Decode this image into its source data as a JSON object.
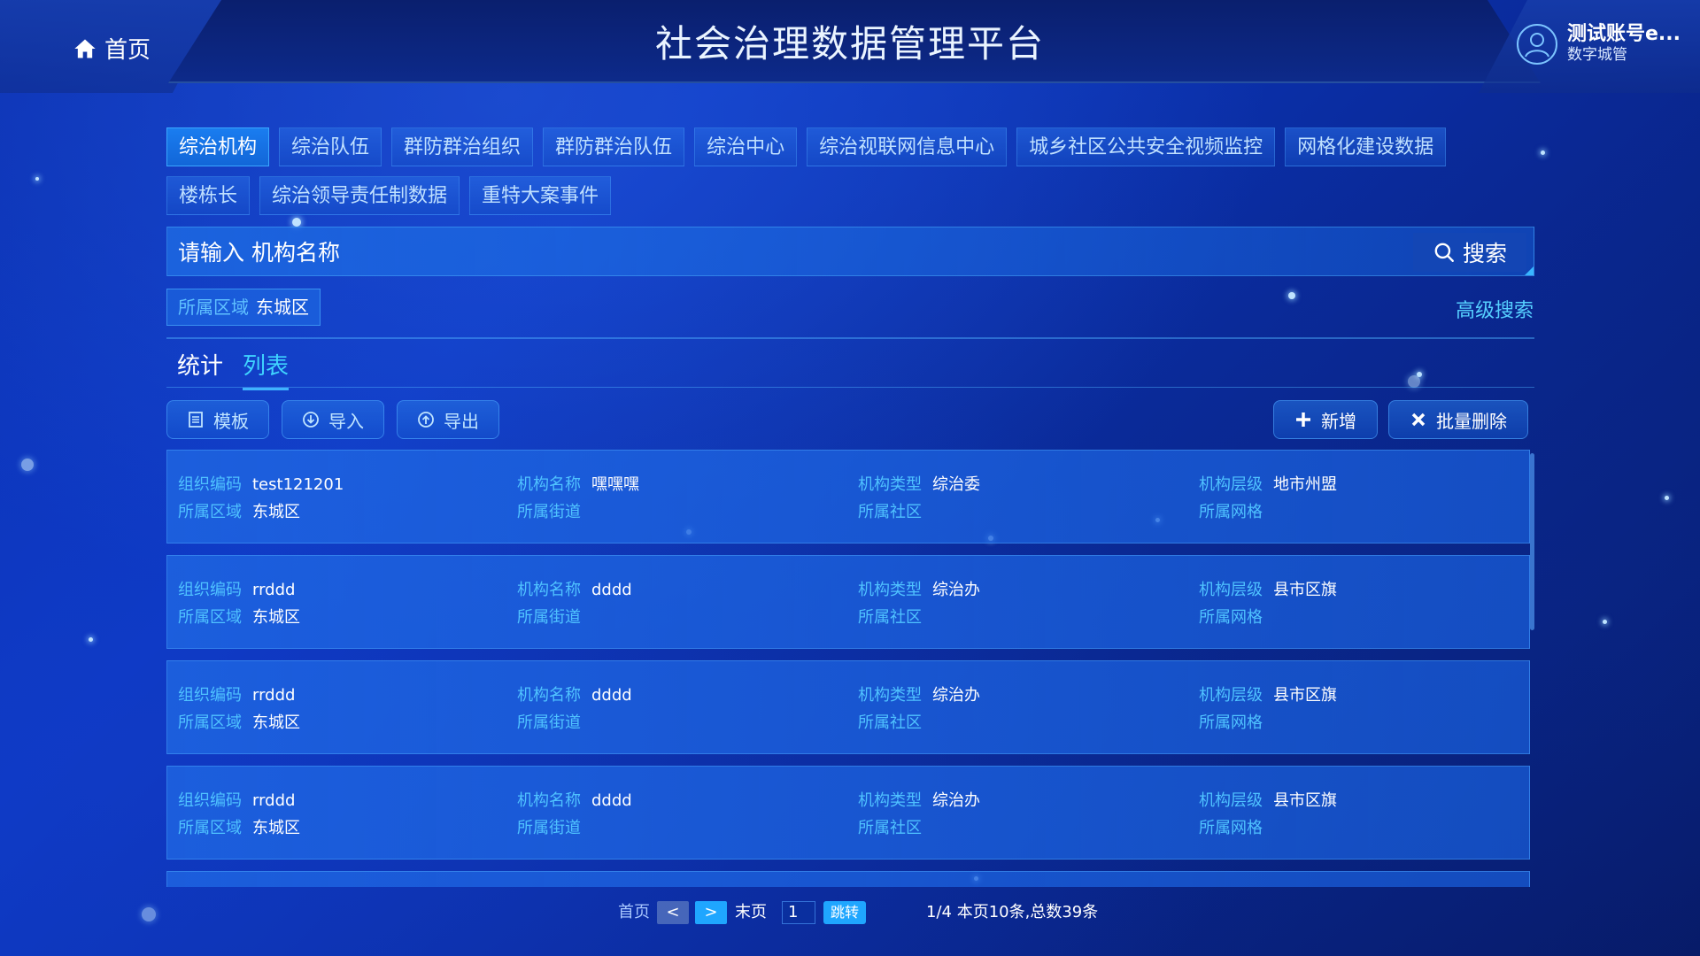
{
  "header": {
    "home_label": "首页",
    "title": "社会治理数据管理平台",
    "user_name": "测试账号e...",
    "user_sub": "数字城管"
  },
  "tabs_row1": [
    "综治机构",
    "综治队伍",
    "群防群治组织",
    "群防群治队伍",
    "综治中心",
    "综治视联网信息中心",
    "城乡社区公共安全视频监控",
    "网格化建设数据"
  ],
  "tabs_row2": [
    "楼栋长",
    "综治领导责任制数据",
    "重特大案事件"
  ],
  "active_tab": "综治机构",
  "search": {
    "placeholder": "请输入 机构名称",
    "button_label": "搜索"
  },
  "filter": {
    "key": "所属区域",
    "value": "东城区"
  },
  "advanced_search_label": "高级搜索",
  "view_tabs": {
    "stats": "统计",
    "list": "列表"
  },
  "toolbar": {
    "template": "模板",
    "import": "导入",
    "export": "导出",
    "add": "新增",
    "batch_delete": "批量删除"
  },
  "field_labels": {
    "code": "组织编码",
    "name": "机构名称",
    "type": "机构类型",
    "level": "机构层级",
    "region": "所属区域",
    "street": "所属街道",
    "community": "所属社区",
    "grid": "所属网格"
  },
  "records": [
    {
      "code": "test121201",
      "name": "嘿嘿嘿",
      "type": "综治委",
      "level": "地市州盟",
      "region": "东城区",
      "street": "",
      "community": "",
      "grid": ""
    },
    {
      "code": "rrddd",
      "name": "dddd",
      "type": "综治办",
      "level": "县市区旗",
      "region": "东城区",
      "street": "",
      "community": "",
      "grid": ""
    },
    {
      "code": "rrddd",
      "name": "dddd",
      "type": "综治办",
      "level": "县市区旗",
      "region": "东城区",
      "street": "",
      "community": "",
      "grid": ""
    },
    {
      "code": "rrddd",
      "name": "dddd",
      "type": "综治办",
      "level": "县市区旗",
      "region": "东城区",
      "street": "",
      "community": "",
      "grid": ""
    }
  ],
  "pager": {
    "first": "首页",
    "prev": "<",
    "next": ">",
    "last": "末页",
    "page_input": "1",
    "jump": "跳转",
    "info": "1/4 本页10条,总数39条"
  },
  "colors": {
    "accent": "#1fa6ff",
    "label": "#4fc2ff",
    "active_tab": "#1a7df0"
  }
}
